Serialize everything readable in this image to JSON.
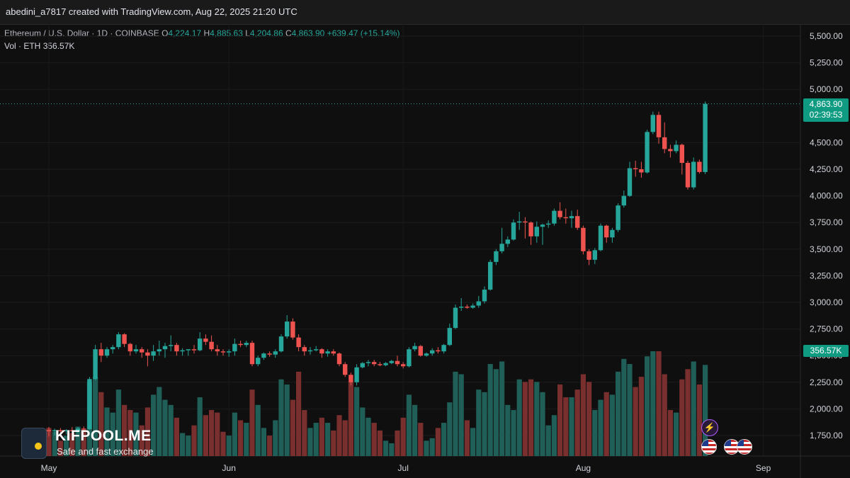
{
  "header": {
    "credit": "abedini_a7817 created with TradingView.com, Aug 22, 2025 21:20 UTC"
  },
  "legend": {
    "symbol": "Ethereum / U.S. Dollar · 1D · COINBASE",
    "o_label": "O",
    "o_value": "4,224.17",
    "h_label": "H",
    "h_value": "4,885.63",
    "l_label": "L",
    "l_value": "4,204.86",
    "c_label": "C",
    "c_value": "4,863.90",
    "change": "+639.47 (+15.14%)",
    "vol_label": "Vol · ETH",
    "vol_value": "356.57K"
  },
  "price_tags": {
    "last_price": "4,863.90",
    "countdown": "02:39:53",
    "volume": "356.57K"
  },
  "watermark": {
    "title": "KIFPOOL.ME",
    "subtitle": "Safe and fast exchange"
  },
  "colors": {
    "up": "#26a69a",
    "down": "#ef5350",
    "up_vol": "#1f5f58",
    "down_vol": "#7a2f2f",
    "background": "#0f0f0f",
    "tag": "#0f9b82"
  },
  "icons": [
    "flash-event-icon",
    "us-flag-icon"
  ],
  "chart_data": {
    "type": "candlestick",
    "symbol": "ETHUSD",
    "x_ticks": [
      "May",
      "Jun",
      "Jul",
      "Aug",
      "Sep"
    ],
    "y_ticks": [
      "1,750.00",
      "2,000.00",
      "2,250.00",
      "2,500.00",
      "2,750.00",
      "3,000.00",
      "3,250.00",
      "3,500.00",
      "3,750.00",
      "4,000.00",
      "4,250.00",
      "4,500.00",
      "5,000.00",
      "5,250.00",
      "5,500.00"
    ],
    "ylim": [
      1620,
      5620
    ],
    "grid": true,
    "candles": [
      {
        "date": "2025-05-01",
        "o": 1800,
        "h": 1830,
        "l": 1740,
        "c": 1790,
        "v": 110
      },
      {
        "date": "2025-05-02",
        "o": 1790,
        "h": 1815,
        "l": 1750,
        "c": 1800,
        "v": 95
      },
      {
        "date": "2025-05-03",
        "o": 1800,
        "h": 1820,
        "l": 1770,
        "c": 1790,
        "v": 60
      },
      {
        "date": "2025-05-04",
        "o": 1790,
        "h": 1810,
        "l": 1760,
        "c": 1800,
        "v": 80
      },
      {
        "date": "2025-05-05",
        "o": 1800,
        "h": 1830,
        "l": 1780,
        "c": 1790,
        "v": 90
      },
      {
        "date": "2025-05-06",
        "o": 1790,
        "h": 1830,
        "l": 1770,
        "c": 1815,
        "v": 115
      },
      {
        "date": "2025-05-07",
        "o": 1815,
        "h": 1835,
        "l": 1790,
        "c": 1810,
        "v": 105
      },
      {
        "date": "2025-05-08",
        "o": 1810,
        "h": 2300,
        "l": 1800,
        "c": 2280,
        "v": 290
      },
      {
        "date": "2025-05-09",
        "o": 2280,
        "h": 2600,
        "l": 2270,
        "c": 2560,
        "v": 310
      },
      {
        "date": "2025-05-10",
        "o": 2560,
        "h": 2620,
        "l": 2440,
        "c": 2500,
        "v": 250
      },
      {
        "date": "2025-05-11",
        "o": 2500,
        "h": 2580,
        "l": 2480,
        "c": 2560,
        "v": 190
      },
      {
        "date": "2025-05-12",
        "o": 2560,
        "h": 2600,
        "l": 2520,
        "c": 2580,
        "v": 170
      },
      {
        "date": "2025-05-13",
        "o": 2580,
        "h": 2720,
        "l": 2560,
        "c": 2700,
        "v": 260
      },
      {
        "date": "2025-05-14",
        "o": 2700,
        "h": 2710,
        "l": 2580,
        "c": 2610,
        "v": 200
      },
      {
        "date": "2025-05-15",
        "o": 2610,
        "h": 2620,
        "l": 2500,
        "c": 2540,
        "v": 180
      },
      {
        "date": "2025-05-16",
        "o": 2540,
        "h": 2600,
        "l": 2520,
        "c": 2560,
        "v": 170
      },
      {
        "date": "2025-05-17",
        "o": 2560,
        "h": 2580,
        "l": 2480,
        "c": 2530,
        "v": 120
      },
      {
        "date": "2025-05-18",
        "o": 2530,
        "h": 2560,
        "l": 2400,
        "c": 2500,
        "v": 190
      },
      {
        "date": "2025-05-19",
        "o": 2500,
        "h": 2600,
        "l": 2450,
        "c": 2540,
        "v": 240
      },
      {
        "date": "2025-05-20",
        "o": 2540,
        "h": 2640,
        "l": 2500,
        "c": 2560,
        "v": 270
      },
      {
        "date": "2025-05-21",
        "o": 2560,
        "h": 2620,
        "l": 2480,
        "c": 2590,
        "v": 220
      },
      {
        "date": "2025-05-22",
        "o": 2590,
        "h": 2690,
        "l": 2540,
        "c": 2600,
        "v": 200
      },
      {
        "date": "2025-05-23",
        "o": 2600,
        "h": 2620,
        "l": 2500,
        "c": 2540,
        "v": 150
      },
      {
        "date": "2025-05-24",
        "o": 2540,
        "h": 2570,
        "l": 2500,
        "c": 2550,
        "v": 90
      },
      {
        "date": "2025-05-25",
        "o": 2550,
        "h": 2560,
        "l": 2500,
        "c": 2560,
        "v": 80
      },
      {
        "date": "2025-05-26",
        "o": 2560,
        "h": 2600,
        "l": 2520,
        "c": 2550,
        "v": 120
      },
      {
        "date": "2025-05-27",
        "o": 2550,
        "h": 2720,
        "l": 2540,
        "c": 2660,
        "v": 230
      },
      {
        "date": "2025-05-28",
        "o": 2660,
        "h": 2700,
        "l": 2600,
        "c": 2630,
        "v": 160
      },
      {
        "date": "2025-05-29",
        "o": 2630,
        "h": 2690,
        "l": 2540,
        "c": 2560,
        "v": 180
      },
      {
        "date": "2025-05-30",
        "o": 2560,
        "h": 2600,
        "l": 2500,
        "c": 2540,
        "v": 170
      },
      {
        "date": "2025-05-31",
        "o": 2540,
        "h": 2560,
        "l": 2500,
        "c": 2530,
        "v": 95
      },
      {
        "date": "2025-06-01",
        "o": 2530,
        "h": 2560,
        "l": 2490,
        "c": 2540,
        "v": 80
      },
      {
        "date": "2025-06-02",
        "o": 2540,
        "h": 2660,
        "l": 2500,
        "c": 2610,
        "v": 170
      },
      {
        "date": "2025-06-03",
        "o": 2610,
        "h": 2640,
        "l": 2580,
        "c": 2600,
        "v": 140
      },
      {
        "date": "2025-06-04",
        "o": 2600,
        "h": 2640,
        "l": 2580,
        "c": 2620,
        "v": 130
      },
      {
        "date": "2025-06-05",
        "o": 2620,
        "h": 2640,
        "l": 2400,
        "c": 2420,
        "v": 260
      },
      {
        "date": "2025-06-06",
        "o": 2420,
        "h": 2500,
        "l": 2400,
        "c": 2480,
        "v": 200
      },
      {
        "date": "2025-06-07",
        "o": 2480,
        "h": 2530,
        "l": 2460,
        "c": 2520,
        "v": 110
      },
      {
        "date": "2025-06-08",
        "o": 2520,
        "h": 2540,
        "l": 2490,
        "c": 2510,
        "v": 80
      },
      {
        "date": "2025-06-09",
        "o": 2510,
        "h": 2560,
        "l": 2480,
        "c": 2540,
        "v": 140
      },
      {
        "date": "2025-06-10",
        "o": 2540,
        "h": 2700,
        "l": 2530,
        "c": 2680,
        "v": 300
      },
      {
        "date": "2025-06-11",
        "o": 2680,
        "h": 2880,
        "l": 2660,
        "c": 2820,
        "v": 280
      },
      {
        "date": "2025-06-12",
        "o": 2820,
        "h": 2850,
        "l": 2650,
        "c": 2670,
        "v": 220
      },
      {
        "date": "2025-06-13",
        "o": 2670,
        "h": 2700,
        "l": 2540,
        "c": 2580,
        "v": 330
      },
      {
        "date": "2025-06-14",
        "o": 2580,
        "h": 2600,
        "l": 2500,
        "c": 2540,
        "v": 180
      },
      {
        "date": "2025-06-15",
        "o": 2540,
        "h": 2580,
        "l": 2510,
        "c": 2550,
        "v": 110
      },
      {
        "date": "2025-06-16",
        "o": 2550,
        "h": 2590,
        "l": 2540,
        "c": 2560,
        "v": 130
      },
      {
        "date": "2025-06-17",
        "o": 2560,
        "h": 2570,
        "l": 2480,
        "c": 2520,
        "v": 150
      },
      {
        "date": "2025-06-18",
        "o": 2520,
        "h": 2560,
        "l": 2490,
        "c": 2540,
        "v": 130
      },
      {
        "date": "2025-06-19",
        "o": 2540,
        "h": 2560,
        "l": 2500,
        "c": 2520,
        "v": 100
      },
      {
        "date": "2025-06-20",
        "o": 2520,
        "h": 2530,
        "l": 2400,
        "c": 2420,
        "v": 160
      },
      {
        "date": "2025-06-21",
        "o": 2420,
        "h": 2440,
        "l": 2300,
        "c": 2320,
        "v": 140
      },
      {
        "date": "2025-06-22",
        "o": 2320,
        "h": 2340,
        "l": 2220,
        "c": 2250,
        "v": 290
      },
      {
        "date": "2025-06-23",
        "o": 2250,
        "h": 2420,
        "l": 2220,
        "c": 2390,
        "v": 270
      },
      {
        "date": "2025-06-24",
        "o": 2390,
        "h": 2440,
        "l": 2380,
        "c": 2430,
        "v": 190
      },
      {
        "date": "2025-06-25",
        "o": 2430,
        "h": 2460,
        "l": 2400,
        "c": 2440,
        "v": 150
      },
      {
        "date": "2025-06-26",
        "o": 2440,
        "h": 2460,
        "l": 2400,
        "c": 2420,
        "v": 130
      },
      {
        "date": "2025-06-27",
        "o": 2420,
        "h": 2440,
        "l": 2400,
        "c": 2410,
        "v": 100
      },
      {
        "date": "2025-06-28",
        "o": 2410,
        "h": 2440,
        "l": 2400,
        "c": 2430,
        "v": 60
      },
      {
        "date": "2025-06-29",
        "o": 2430,
        "h": 2460,
        "l": 2420,
        "c": 2450,
        "v": 50
      },
      {
        "date": "2025-06-30",
        "o": 2450,
        "h": 2500,
        "l": 2400,
        "c": 2420,
        "v": 100
      },
      {
        "date": "2025-07-01",
        "o": 2420,
        "h": 2440,
        "l": 2380,
        "c": 2400,
        "v": 150
      },
      {
        "date": "2025-07-02",
        "o": 2400,
        "h": 2580,
        "l": 2390,
        "c": 2560,
        "v": 240
      },
      {
        "date": "2025-07-03",
        "o": 2560,
        "h": 2620,
        "l": 2540,
        "c": 2590,
        "v": 200
      },
      {
        "date": "2025-07-04",
        "o": 2590,
        "h": 2600,
        "l": 2490,
        "c": 2500,
        "v": 130
      },
      {
        "date": "2025-07-05",
        "o": 2500,
        "h": 2530,
        "l": 2490,
        "c": 2520,
        "v": 60
      },
      {
        "date": "2025-07-06",
        "o": 2520,
        "h": 2570,
        "l": 2500,
        "c": 2550,
        "v": 70
      },
      {
        "date": "2025-07-07",
        "o": 2550,
        "h": 2580,
        "l": 2520,
        "c": 2540,
        "v": 110
      },
      {
        "date": "2025-07-08",
        "o": 2540,
        "h": 2610,
        "l": 2520,
        "c": 2600,
        "v": 130
      },
      {
        "date": "2025-07-09",
        "o": 2600,
        "h": 2800,
        "l": 2590,
        "c": 2760,
        "v": 210
      },
      {
        "date": "2025-07-10",
        "o": 2760,
        "h": 2980,
        "l": 2750,
        "c": 2950,
        "v": 330
      },
      {
        "date": "2025-07-11",
        "o": 2950,
        "h": 3040,
        "l": 2920,
        "c": 2960,
        "v": 320
      },
      {
        "date": "2025-07-12",
        "o": 2960,
        "h": 2980,
        "l": 2940,
        "c": 2950,
        "v": 140
      },
      {
        "date": "2025-07-13",
        "o": 2950,
        "h": 2990,
        "l": 2940,
        "c": 2970,
        "v": 110
      },
      {
        "date": "2025-07-14",
        "o": 2970,
        "h": 3060,
        "l": 2950,
        "c": 3010,
        "v": 260
      },
      {
        "date": "2025-07-15",
        "o": 3010,
        "h": 3150,
        "l": 2990,
        "c": 3120,
        "v": 250
      },
      {
        "date": "2025-07-16",
        "o": 3120,
        "h": 3400,
        "l": 3110,
        "c": 3380,
        "v": 360
      },
      {
        "date": "2025-07-17",
        "o": 3380,
        "h": 3500,
        "l": 3350,
        "c": 3480,
        "v": 340
      },
      {
        "date": "2025-07-18",
        "o": 3480,
        "h": 3700,
        "l": 3460,
        "c": 3550,
        "v": 370
      },
      {
        "date": "2025-07-19",
        "o": 3550,
        "h": 3620,
        "l": 3520,
        "c": 3590,
        "v": 200
      },
      {
        "date": "2025-07-20",
        "o": 3590,
        "h": 3780,
        "l": 3580,
        "c": 3750,
        "v": 180
      },
      {
        "date": "2025-07-21",
        "o": 3750,
        "h": 3850,
        "l": 3680,
        "c": 3760,
        "v": 300
      },
      {
        "date": "2025-07-22",
        "o": 3760,
        "h": 3800,
        "l": 3600,
        "c": 3750,
        "v": 290
      },
      {
        "date": "2025-07-23",
        "o": 3750,
        "h": 3760,
        "l": 3540,
        "c": 3620,
        "v": 300
      },
      {
        "date": "2025-07-24",
        "o": 3620,
        "h": 3760,
        "l": 3560,
        "c": 3710,
        "v": 290
      },
      {
        "date": "2025-07-25",
        "o": 3710,
        "h": 3740,
        "l": 3540,
        "c": 3730,
        "v": 250
      },
      {
        "date": "2025-07-26",
        "o": 3730,
        "h": 3770,
        "l": 3700,
        "c": 3740,
        "v": 120
      },
      {
        "date": "2025-07-27",
        "o": 3740,
        "h": 3880,
        "l": 3720,
        "c": 3860,
        "v": 160
      },
      {
        "date": "2025-07-28",
        "o": 3860,
        "h": 3940,
        "l": 3780,
        "c": 3800,
        "v": 280
      },
      {
        "date": "2025-07-29",
        "o": 3800,
        "h": 3880,
        "l": 3740,
        "c": 3790,
        "v": 230
      },
      {
        "date": "2025-07-30",
        "o": 3790,
        "h": 3860,
        "l": 3700,
        "c": 3810,
        "v": 230
      },
      {
        "date": "2025-07-31",
        "o": 3810,
        "h": 3870,
        "l": 3680,
        "c": 3700,
        "v": 260
      },
      {
        "date": "2025-08-01",
        "o": 3700,
        "h": 3720,
        "l": 3450,
        "c": 3480,
        "v": 320
      },
      {
        "date": "2025-08-02",
        "o": 3480,
        "h": 3500,
        "l": 3350,
        "c": 3400,
        "v": 290
      },
      {
        "date": "2025-08-03",
        "o": 3400,
        "h": 3510,
        "l": 3360,
        "c": 3490,
        "v": 180
      },
      {
        "date": "2025-08-04",
        "o": 3490,
        "h": 3740,
        "l": 3480,
        "c": 3720,
        "v": 220
      },
      {
        "date": "2025-08-05",
        "o": 3720,
        "h": 3730,
        "l": 3560,
        "c": 3610,
        "v": 250
      },
      {
        "date": "2025-08-06",
        "o": 3610,
        "h": 3700,
        "l": 3560,
        "c": 3680,
        "v": 240
      },
      {
        "date": "2025-08-07",
        "o": 3680,
        "h": 3930,
        "l": 3660,
        "c": 3910,
        "v": 330
      },
      {
        "date": "2025-08-08",
        "o": 3910,
        "h": 4050,
        "l": 3890,
        "c": 4000,
        "v": 380
      },
      {
        "date": "2025-08-09",
        "o": 4000,
        "h": 4320,
        "l": 3990,
        "c": 4260,
        "v": 360
      },
      {
        "date": "2025-08-10",
        "o": 4260,
        "h": 4330,
        "l": 4180,
        "c": 4250,
        "v": 270
      },
      {
        "date": "2025-08-11",
        "o": 4250,
        "h": 4320,
        "l": 4170,
        "c": 4220,
        "v": 310
      },
      {
        "date": "2025-08-12",
        "o": 4220,
        "h": 4620,
        "l": 4210,
        "c": 4600,
        "v": 390
      },
      {
        "date": "2025-08-13",
        "o": 4600,
        "h": 4790,
        "l": 4580,
        "c": 4760,
        "v": 410
      },
      {
        "date": "2025-08-14",
        "o": 4760,
        "h": 4790,
        "l": 4490,
        "c": 4550,
        "v": 410
      },
      {
        "date": "2025-08-15",
        "o": 4550,
        "h": 4690,
        "l": 4400,
        "c": 4440,
        "v": 320
      },
      {
        "date": "2025-08-16",
        "o": 4440,
        "h": 4480,
        "l": 4360,
        "c": 4420,
        "v": 180
      },
      {
        "date": "2025-08-17",
        "o": 4420,
        "h": 4520,
        "l": 4400,
        "c": 4480,
        "v": 170
      },
      {
        "date": "2025-08-18",
        "o": 4480,
        "h": 4490,
        "l": 4200,
        "c": 4310,
        "v": 300
      },
      {
        "date": "2025-08-19",
        "o": 4310,
        "h": 4330,
        "l": 4060,
        "c": 4080,
        "v": 340
      },
      {
        "date": "2025-08-20",
        "o": 4080,
        "h": 4360,
        "l": 4060,
        "c": 4320,
        "v": 370
      },
      {
        "date": "2025-08-21",
        "o": 4320,
        "h": 4340,
        "l": 4210,
        "c": 4224.17,
        "v": 280
      },
      {
        "date": "2025-08-22",
        "o": 4224.17,
        "h": 4885.63,
        "l": 4204.86,
        "c": 4863.9,
        "v": 356.57
      }
    ]
  }
}
